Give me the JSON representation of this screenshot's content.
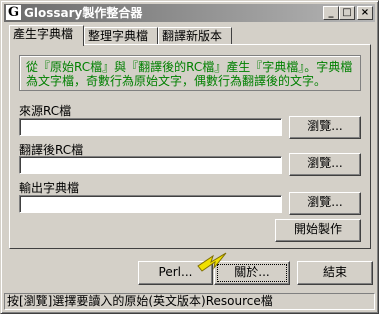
{
  "window": {
    "title": "Glossary製作整合器",
    "logo_letter": "G",
    "controls": {
      "minimize": "_",
      "maximize": "□",
      "close": "×"
    }
  },
  "tabs": [
    {
      "label": "產生字典檔",
      "active": true
    },
    {
      "label": "整理字典檔",
      "active": false
    },
    {
      "label": "翻譯新版本",
      "active": false
    }
  ],
  "panel": {
    "info_text": "從『原始RC檔』與『翻譯後的RC檔』產生『字典檔』。字典檔為文字檔，奇數行為原始文字，偶數行為翻譯後的文字。",
    "fields": [
      {
        "label": "來源RC檔",
        "value": "",
        "browse_label": "瀏覽..."
      },
      {
        "label": "翻譯後RC檔",
        "value": "",
        "browse_label": "瀏覽..."
      },
      {
        "label": "輸出字典檔",
        "value": "",
        "browse_label": "瀏覽..."
      }
    ],
    "start_label": "開始製作"
  },
  "footer": {
    "perl_label": "Perl...",
    "about_label": "關於...",
    "close_label": "結束"
  },
  "status": "按[瀏覽]選擇要讀入的原始(英文版本)Resource檔",
  "colors": {
    "info_text": "#008000",
    "titlebar": "#808080",
    "arrow": "#f0e000"
  }
}
